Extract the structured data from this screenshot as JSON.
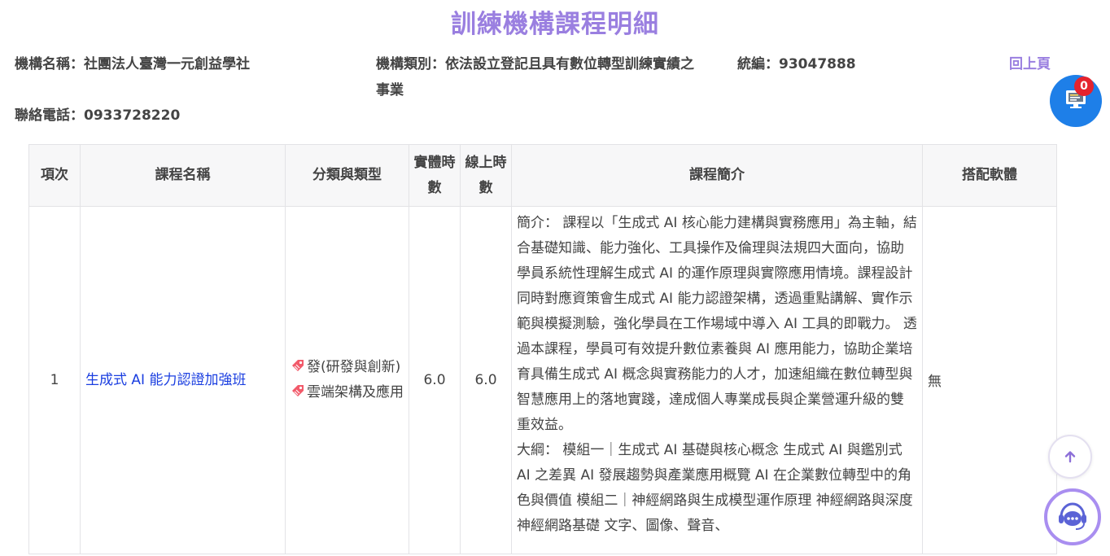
{
  "page": {
    "title": "訓練機構課程明細"
  },
  "org": {
    "name": "機構名稱：社團法人臺灣一元創益學社",
    "type": "機構類別：依法設立登記且具有數位轉型訓練實績之事業",
    "tax_id": "統編：93047888",
    "phone": "聯絡電話：0933728220"
  },
  "nav": {
    "back_label": "回上頁"
  },
  "cart": {
    "count": "0"
  },
  "table": {
    "headers": {
      "idx": "項次",
      "name": "課程名稱",
      "category": "分類與類型",
      "physical": "實體時數",
      "online": "線上時數",
      "intro": "課程簡介",
      "software": "搭配軟體"
    },
    "rows": [
      {
        "idx": "1",
        "name": "生成式 AI 能力認證加強班",
        "categories": [
          "發(研發與創新)",
          "雲端架構及應用"
        ],
        "physical": "6.0",
        "online": "6.0",
        "intro": "簡介： 課程以「生成式 AI 核心能力建構與實務應用」為主軸，結合基礎知識、能力強化、工具操作及倫理與法規四大面向，協助學員系統性理解生成式 AI 的運作原理與實際應用情境。課程設計同時對應資策會生成式 AI 能力認證架構，透過重點講解、實作示範與模擬測驗，強化學員在工作場域中導入 AI 工具的即戰力。 透過本課程，學員可有效提升數位素養與 AI 應用能力，協助企業培育具備生成式 AI 概念與實務能力的人才，加速組織在數位轉型與智慧應用上的落地實踐，達成個人專業成長與企業營運升級的雙重效益。",
        "outline": "大綱： 模組一｜生成式 AI 基礎與核心概念 生成式 AI 與鑑別式 AI 之差異 AI 發展趨勢與產業應用概覽 AI 在企業數位轉型中的角色與價值 模組二｜神經網路與生成模型運作原理 神經網路與深度神經網路基礎 文字、圖像、聲音、",
        "software": "無"
      }
    ]
  },
  "colors": {
    "accent": "#9a7fe0",
    "link": "#1a3ee0",
    "cart": "#1e7fe8",
    "badge": "#e5232d"
  },
  "icons": {
    "cart": "monitor-cart-icon",
    "tag": "tag-icon",
    "scroll": "arrow-up-icon",
    "chat": "chat-bot-icon"
  }
}
